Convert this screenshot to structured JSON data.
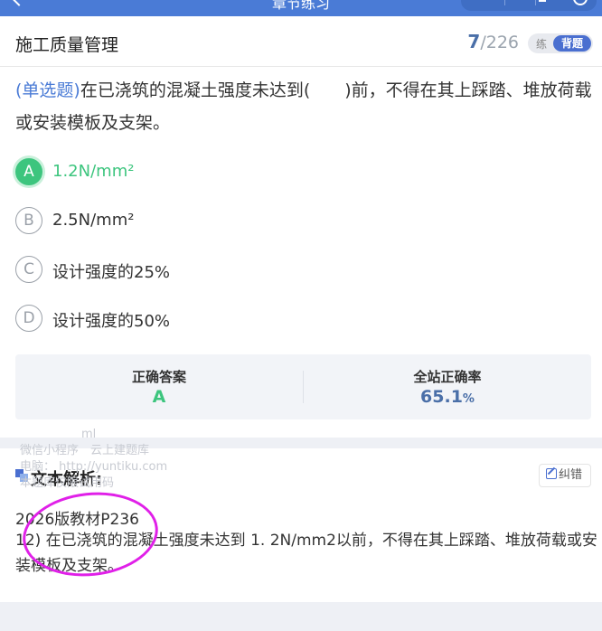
{
  "topbar": {
    "title": "章节练习"
  },
  "header": {
    "title": "施工质量管理",
    "current": "7",
    "separator": "/",
    "total": "226",
    "mode_practice": "练",
    "mode_memorize": "背题"
  },
  "question": {
    "type": "(单选题)",
    "text": "在已浇筑的混凝土强度未达到(　　)前，不得在其上踩踏、堆放荷载或安装模板及支架。"
  },
  "options": [
    {
      "letter": "A",
      "text": "1.2N/mm²"
    },
    {
      "letter": "B",
      "text": "2.5N/mm²"
    },
    {
      "letter": "C",
      "text": "设计强度的25%"
    },
    {
      "letter": "D",
      "text": "设计强度的50%"
    }
  ],
  "stats": {
    "answer_label": "正确答案",
    "answer_value": "A",
    "rate_label": "全站正确率",
    "rate_value": "65.1",
    "rate_unit": "%"
  },
  "analysis": {
    "heading": "文本解析:",
    "fix_label": "纠错",
    "line1": "2026版教材P236",
    "line2": "12) 在已浇筑的混凝土强度未达到 1. 2N/mm2以前，不得在其上踩踏、堆放荷载或安装模板及支架。"
  },
  "watermark": {
    "w1": "ml",
    "w2": "微信小程序　云上建题库",
    "w3": "电脑：  http://yuntiku.com",
    "w4": "本题库仅限试用码"
  },
  "colors": {
    "accent": "#4a7bd6",
    "correct": "#3dc57e",
    "annotation": "#e020e8"
  }
}
